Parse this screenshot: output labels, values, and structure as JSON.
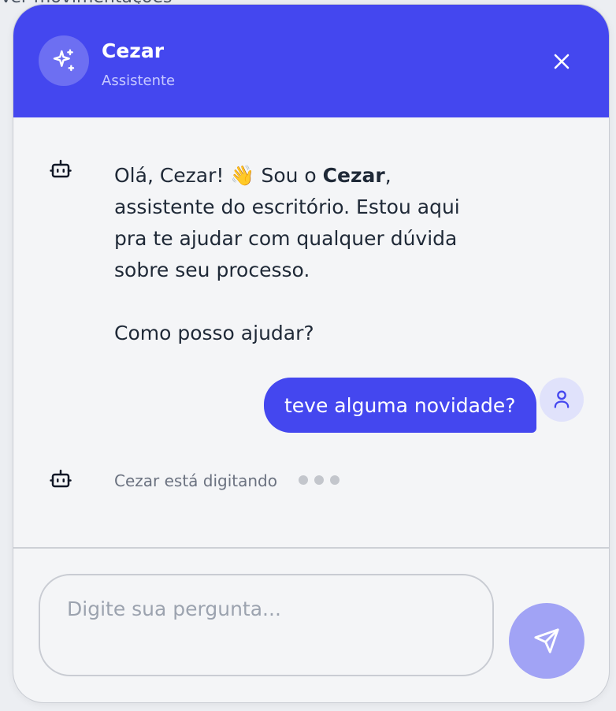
{
  "header": {
    "title": "Cezar",
    "subtitle": "Assistente",
    "avatar_icon": "sparkles-icon",
    "close_icon": "close-icon",
    "color": "#4447ef"
  },
  "messages": {
    "bot_greeting": {
      "line1_prefix": "Olá, Cezar! ",
      "emoji": "👋",
      "line1_mid": " Sou o ",
      "name_bold": "Cezar",
      "line1_suffix": ", assistente do escritório. Estou aqui pra te ajudar com qualquer dúvida sobre seu processo.",
      "line2": "Como posso ajudar?"
    },
    "user_message": "teve alguma novidade?",
    "typing_indicator": "Cezar está digitando",
    "bot_icon": "robot-icon",
    "user_icon": "user-icon"
  },
  "composer": {
    "placeholder": "Digite sua pergunta...",
    "value": "",
    "send_icon": "send-icon",
    "send_color": "#a1a3f5"
  },
  "backdrop": {
    "text": "Ver movimentações"
  }
}
